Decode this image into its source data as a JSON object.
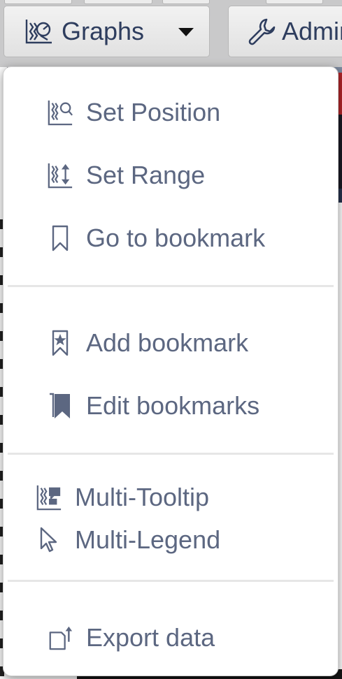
{
  "toolbar": {
    "graphs_button": {
      "label": "Graphs",
      "icon": "graphs-icon"
    },
    "admin_button": {
      "label": "Admin",
      "icon": "wrench-icon"
    }
  },
  "graphs_menu": {
    "sections": [
      {
        "items": [
          {
            "label": "Set Position",
            "icon": "set-position-icon"
          },
          {
            "label": "Set Range",
            "icon": "set-range-icon"
          },
          {
            "label": "Go to bookmark",
            "icon": "bookmark-outline-icon"
          }
        ]
      },
      {
        "items": [
          {
            "label": "Add bookmark",
            "icon": "bookmark-star-icon"
          },
          {
            "label": "Edit bookmarks",
            "icon": "bookmark-filled-icon"
          }
        ]
      },
      {
        "items": [
          {
            "label": "Multi-Tooltip",
            "icon": "multi-tooltip-icon"
          },
          {
            "label": "Multi-Legend",
            "icon": "cursor-arrow-icon"
          }
        ]
      },
      {
        "items": [
          {
            "label": "Export data",
            "icon": "export-icon"
          }
        ]
      }
    ]
  },
  "colors": {
    "menu_text": "#5c6781",
    "button_text": "#2e3d5e",
    "menu_background": "#ffffff",
    "separator": "#e6e6e6",
    "toolbar_background": "#c9c9ca"
  }
}
